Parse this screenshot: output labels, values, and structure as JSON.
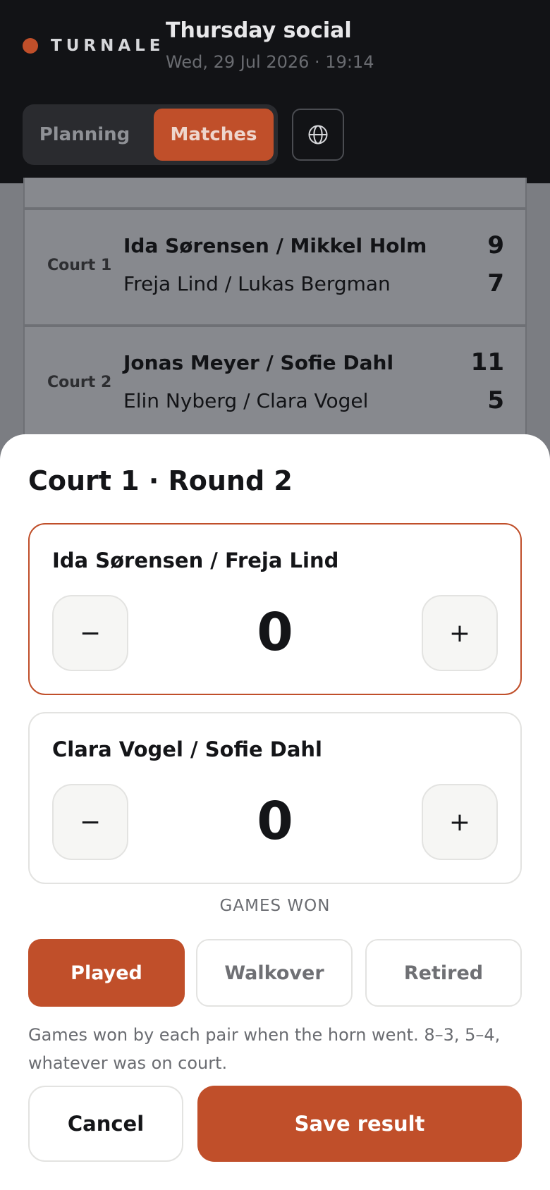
{
  "header": {
    "brand": "TURNALE",
    "title": "Thursday social",
    "subtitle": "Wed, 29 Jul 2026 · 19:14",
    "tabs": [
      "Planning",
      "Matches"
    ],
    "active_tab": "Matches",
    "language_icon": "globe-icon"
  },
  "matches": [
    {
      "court": "Court 1",
      "team1": "Ida Sørensen / Mikkel Holm",
      "score1": "9",
      "team2": "Freja Lind / Lukas Bergman",
      "score2": "7"
    },
    {
      "court": "Court 2",
      "team1": "Jonas Meyer / Sofie Dahl",
      "score1": "11",
      "team2": "Elin Nyberg / Clara Vogel",
      "score2": "5"
    }
  ],
  "sheet": {
    "title": "Court 1 · Round 2",
    "pairs": [
      {
        "name": "Ida Sørensen / Freja Lind",
        "score": "0",
        "minus": "−",
        "plus": "+"
      },
      {
        "name": "Clara Vogel / Sofie Dahl",
        "score": "0",
        "minus": "−",
        "plus": "+"
      }
    ],
    "games_won_label": "GAMES WON",
    "outcomes": [
      "Played",
      "Walkover",
      "Retired"
    ],
    "selected_outcome": "Played",
    "help_text": "Games won by each pair when the horn went. 8–3, 5–4, whatever was on court.",
    "cancel_label": "Cancel",
    "save_label": "Save result"
  },
  "colors": {
    "accent": "#c04f2a",
    "topbar": "#121316",
    "overlay": "#7b7d82"
  }
}
